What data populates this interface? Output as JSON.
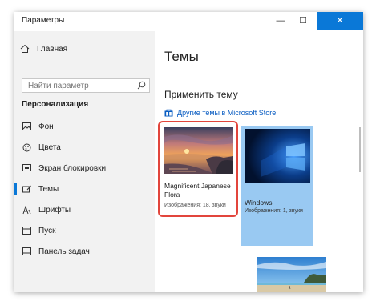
{
  "window": {
    "title": "Параметры",
    "controls": {
      "minimize": "—",
      "maximize": "☐",
      "close": "✕"
    }
  },
  "sidebar": {
    "home_label": "Главная",
    "search_placeholder": "Найти параметр",
    "section_title": "Персонализация",
    "items": [
      {
        "label": "Фон",
        "icon": "image-icon",
        "active": false
      },
      {
        "label": "Цвета",
        "icon": "palette-icon",
        "active": false
      },
      {
        "label": "Экран блокировки",
        "icon": "lock-screen-icon",
        "active": false
      },
      {
        "label": "Темы",
        "icon": "brush-icon",
        "active": true
      },
      {
        "label": "Шрифты",
        "icon": "font-icon",
        "active": false
      },
      {
        "label": "Пуск",
        "icon": "start-icon",
        "active": false
      },
      {
        "label": "Панель задач",
        "icon": "taskbar-icon",
        "active": false
      }
    ]
  },
  "main": {
    "title": "Темы",
    "apply_heading": "Применить тему",
    "store_link": "Другие темы в Microsoft Store",
    "themes": [
      {
        "name": "Magnificent Japanese Flora",
        "meta": "Изображения: 18, звуки",
        "selected": true
      },
      {
        "name": "Windows",
        "meta": "Изображения: 1, звуки",
        "selected": false
      }
    ]
  },
  "colors": {
    "accent": "#0a78d7",
    "selection_outline": "#e2453c",
    "link": "#0a5dc2"
  }
}
